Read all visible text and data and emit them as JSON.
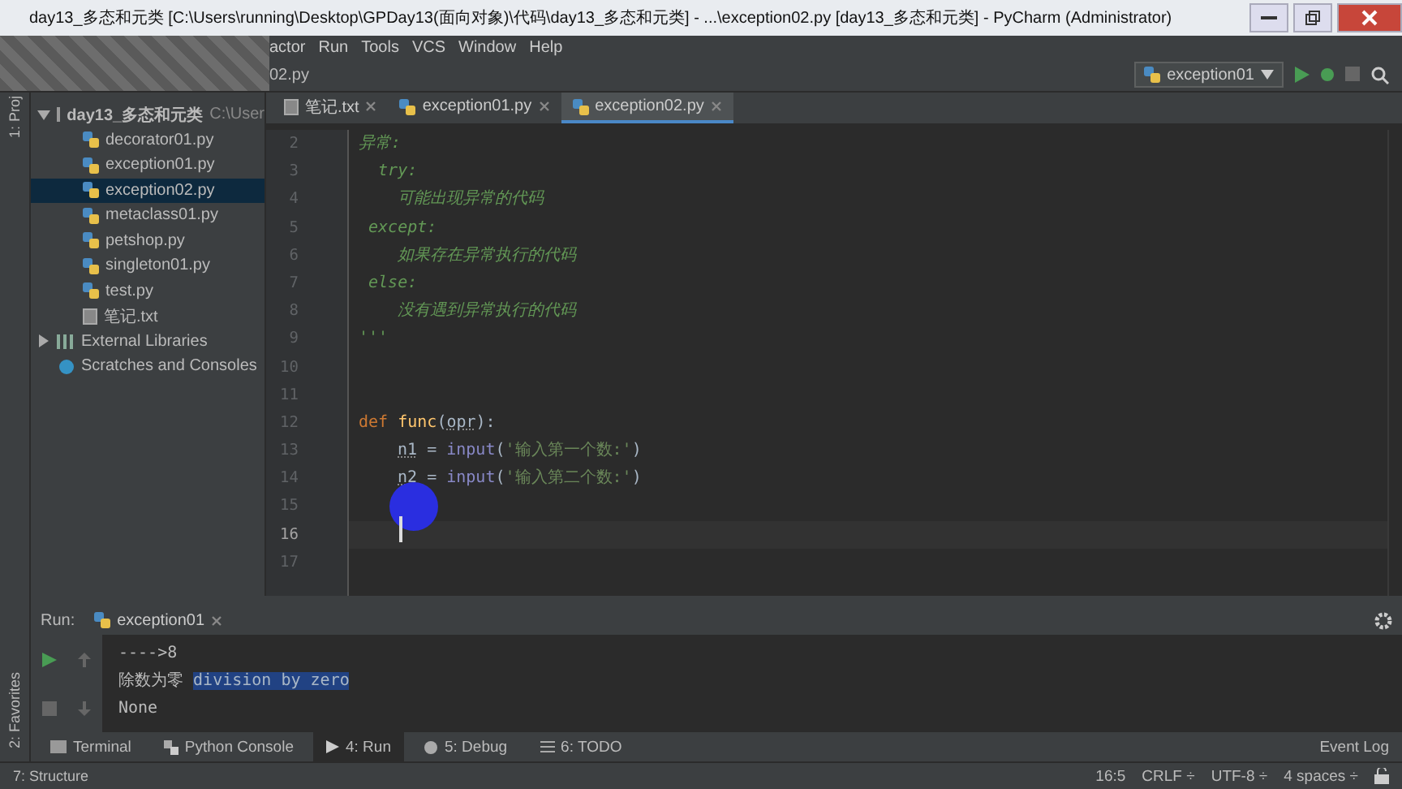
{
  "window": {
    "title": "day13_多态和元类 [C:\\Users\\running\\Desktop\\GPDay13(面向对象)\\代码\\day13_多态和元类] - ...\\exception02.py [day13_多态和元类] - PyCharm (Administrator)"
  },
  "menu": [
    "actor",
    "Run",
    "Tools",
    "VCS",
    "Window",
    "Help"
  ],
  "breadcrumb": "02.py",
  "run_config": "exception01",
  "left_strip": [
    "1: Proj",
    "2: Favorites",
    "7: Structure"
  ],
  "project": {
    "root": {
      "name": "day13_多态和元类",
      "path": "C:\\User",
      "expanded": true
    },
    "files": [
      {
        "name": "decorator01.py",
        "kind": "py",
        "selected": false
      },
      {
        "name": "exception01.py",
        "kind": "py",
        "selected": false
      },
      {
        "name": "exception02.py",
        "kind": "py",
        "selected": true
      },
      {
        "name": "metaclass01.py",
        "kind": "py",
        "selected": false
      },
      {
        "name": "petshop.py",
        "kind": "py",
        "selected": false
      },
      {
        "name": "singleton01.py",
        "kind": "py",
        "selected": false
      },
      {
        "name": "test.py",
        "kind": "py",
        "selected": false
      },
      {
        "name": "笔记.txt",
        "kind": "txt",
        "selected": false
      }
    ],
    "extras": [
      {
        "name": "External Libraries",
        "kind": "lib"
      },
      {
        "name": "Scratches and Consoles",
        "kind": "scratch"
      }
    ]
  },
  "editor_tabs": [
    {
      "label": "笔记.txt",
      "kind": "txt",
      "selected": false
    },
    {
      "label": "exception01.py",
      "kind": "py",
      "selected": false
    },
    {
      "label": "exception02.py",
      "kind": "py",
      "selected": true
    }
  ],
  "code": [
    {
      "num": "2",
      "current": false,
      "segments": [
        {
          "kind": "doc",
          "text": "异常:"
        }
      ]
    },
    {
      "num": "3",
      "current": false,
      "segments": [
        {
          "kind": "doc",
          "text": "  try:"
        }
      ]
    },
    {
      "num": "4",
      "current": false,
      "segments": [
        {
          "kind": "doc",
          "text": "    可能出现异常的代码"
        }
      ]
    },
    {
      "num": "5",
      "current": false,
      "segments": [
        {
          "kind": "doc",
          "text": " except:"
        }
      ]
    },
    {
      "num": "6",
      "current": false,
      "segments": [
        {
          "kind": "doc",
          "text": "    如果存在异常执行的代码"
        }
      ]
    },
    {
      "num": "7",
      "current": false,
      "segments": [
        {
          "kind": "doc",
          "text": " else:"
        }
      ]
    },
    {
      "num": "8",
      "current": false,
      "segments": [
        {
          "kind": "doc",
          "text": "    没有遇到异常执行的代码"
        }
      ]
    },
    {
      "num": "9",
      "current": false,
      "segments": [
        {
          "kind": "doc",
          "text": "'''"
        }
      ]
    },
    {
      "num": "10",
      "current": false
    },
    {
      "num": "11",
      "current": false
    },
    {
      "num": "12",
      "current": false,
      "segments": [
        {
          "kind": "keyword",
          "text": "def "
        },
        {
          "kind": "func",
          "text": "func"
        },
        {
          "kind": "plain",
          "text": "("
        },
        {
          "kind": "param",
          "text": "opr"
        },
        {
          "kind": "plain",
          "text": "):"
        }
      ]
    },
    {
      "num": "13",
      "current": false,
      "indented": true,
      "segments": [
        {
          "kind": "param",
          "text": "n1"
        },
        {
          "kind": "plain",
          "text": " = "
        },
        {
          "kind": "builtin",
          "text": "input"
        },
        {
          "kind": "plain",
          "text": "("
        },
        {
          "kind": "string",
          "text": "'输入第一个数:'"
        },
        {
          "kind": "plain",
          "text": ")"
        }
      ]
    },
    {
      "num": "14",
      "current": false,
      "indented": true,
      "segments": [
        {
          "kind": "param",
          "text": "n2"
        },
        {
          "kind": "plain",
          "text": " = "
        },
        {
          "kind": "builtin",
          "text": "input"
        },
        {
          "kind": "plain",
          "text": "("
        },
        {
          "kind": "string",
          "text": "'输入第二个数:'"
        },
        {
          "kind": "plain",
          "text": ")"
        }
      ]
    },
    {
      "num": "15",
      "current": false
    },
    {
      "num": "16",
      "current": true
    },
    {
      "num": "17",
      "current": false
    }
  ],
  "run": {
    "label": "Run:",
    "tab": "exception01",
    "output": [
      {
        "text": "---->8"
      },
      {
        "text": "除数为零 ",
        "highlight": "division by zero"
      },
      {
        "text": "None"
      }
    ]
  },
  "tool_tabs": [
    {
      "label": "Terminal",
      "kind": "terminal",
      "selected": false
    },
    {
      "label": "Python Console",
      "kind": "console",
      "selected": false
    },
    {
      "label": "4: Run",
      "kind": "run",
      "selected": true
    },
    {
      "label": "5: Debug",
      "kind": "debug",
      "selected": false
    },
    {
      "label": "6: TODO",
      "kind": "todo",
      "selected": false
    }
  ],
  "event_log": "Event Log",
  "status": [
    "16:5",
    "CRLF ÷",
    "UTF-8 ÷",
    "4 spaces ÷"
  ]
}
